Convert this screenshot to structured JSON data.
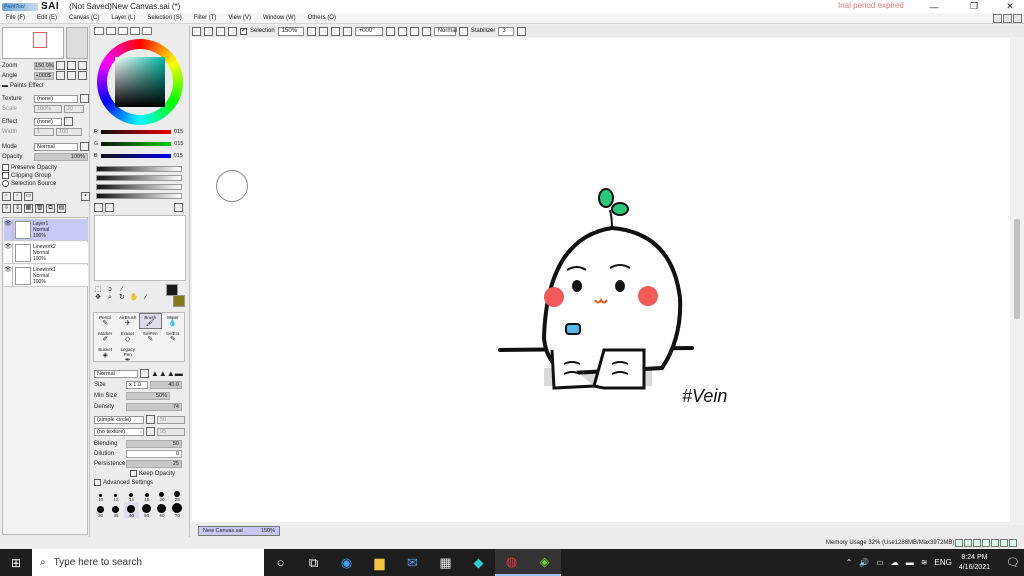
{
  "titlebar": {
    "brand": "SAI",
    "logo_text": "PaintTool",
    "title": "(Not Saved)New Canvas.sai (*)",
    "trial": "Inal period expired",
    "minimize": "—",
    "maximize": "❐",
    "close": "✕"
  },
  "menu": [
    "File (F)",
    "Edit (E)",
    "Canvas (C)",
    "Layer (L)",
    "Selection (S)",
    "Filter (T)",
    "View (V)",
    "Window (W)",
    "Others (O)"
  ],
  "toolbar": {
    "selection_label": "Selection",
    "zoom": "150%",
    "angle": "+000°",
    "mode": "Normal",
    "stabilizer_label": "Stabilizer",
    "stabilizer_value": "3",
    "check": "✓"
  },
  "navigator": {
    "zoom_label": "Zoom",
    "zoom_value": "150.0%",
    "angle_label": "Angle",
    "angle_value": "+000$"
  },
  "paint_effect": {
    "header": "Paints Effect",
    "texture_label": "Texture",
    "texture_value": "(none)",
    "scale_label": "Scale",
    "scale_value": "100%",
    "scale_num": "20",
    "effect_label": "Effect",
    "effect_value": "(none)",
    "width_label": "Width",
    "width_num": "1",
    "width_val": "100"
  },
  "layer_options": {
    "mode_label": "Mode",
    "mode_value": "Normal",
    "opacity_label": "Opacity",
    "opacity_value": "100%",
    "preserve": "Preserve Opacity",
    "clipping": "Clipping Group",
    "selection_source": "Selection Source"
  },
  "layers": [
    {
      "name": "Layer1",
      "mode": "Normal",
      "opacity": "100%",
      "selected": true
    },
    {
      "name": "Linework2",
      "mode": "Normal",
      "opacity": "100%",
      "selected": false
    },
    {
      "name": "Linework1",
      "mode": "Normal",
      "opacity": "100%",
      "selected": false
    }
  ],
  "color": {
    "r_label": "R",
    "r_value": "015",
    "g_label": "G",
    "g_value": "015",
    "b_label": "B",
    "b_value": "015",
    "fg": "#1a1a1a",
    "bg": "#7f7a1a"
  },
  "brush_tools": [
    {
      "label": "Pencil",
      "icon": "✎"
    },
    {
      "label": "AirBrush",
      "icon": "✈"
    },
    {
      "label": "Brush",
      "icon": "🖌"
    },
    {
      "label": "Water",
      "icon": "💧"
    },
    {
      "label": "Marker",
      "icon": "✐"
    },
    {
      "label": "Eraser",
      "icon": "◇"
    },
    {
      "label": "SelPen",
      "icon": "✎"
    },
    {
      "label": "SelErs",
      "icon": "✎"
    },
    {
      "label": "Bucket",
      "icon": "◈"
    },
    {
      "label": "Legacy Pen",
      "icon": "✒"
    }
  ],
  "brush_settings": {
    "mode": "Normal",
    "size_label": "Size",
    "size_mult": "x 1.0",
    "size_value": "40.0",
    "min_size_label": "Min Size",
    "min_size_value": "50%",
    "density_label": "Density",
    "density_value": "74",
    "shape": "(simple circle)",
    "shape_val": "50",
    "texture": "(no texture)",
    "texture_val": "95",
    "blending_label": "Blending",
    "blending_value": "50",
    "dilution_label": "Dilution",
    "dilution_value": "0",
    "persistence_label": "Persistence",
    "persistence_value": "25",
    "keep_opacity": "Keep Opacity",
    "advanced": "Advanced Settings"
  },
  "size_presets": [
    "10",
    "12",
    "14",
    "16",
    "20",
    "25",
    "30",
    "35",
    "40",
    "50",
    "60",
    "70",
    "80",
    "100",
    "120",
    "160"
  ],
  "canvas": {
    "doc_tab": "New Canvas.sai",
    "doc_zoom": "150%",
    "signature": "#Vein"
  },
  "status": {
    "memory": "Memory Usage 32% (Use1286MB/Max3972MB)"
  },
  "taskbar": {
    "search_placeholder": "Type here to search",
    "lang": "ENG",
    "time": "8:24 PM",
    "date": "4/16/2021"
  }
}
